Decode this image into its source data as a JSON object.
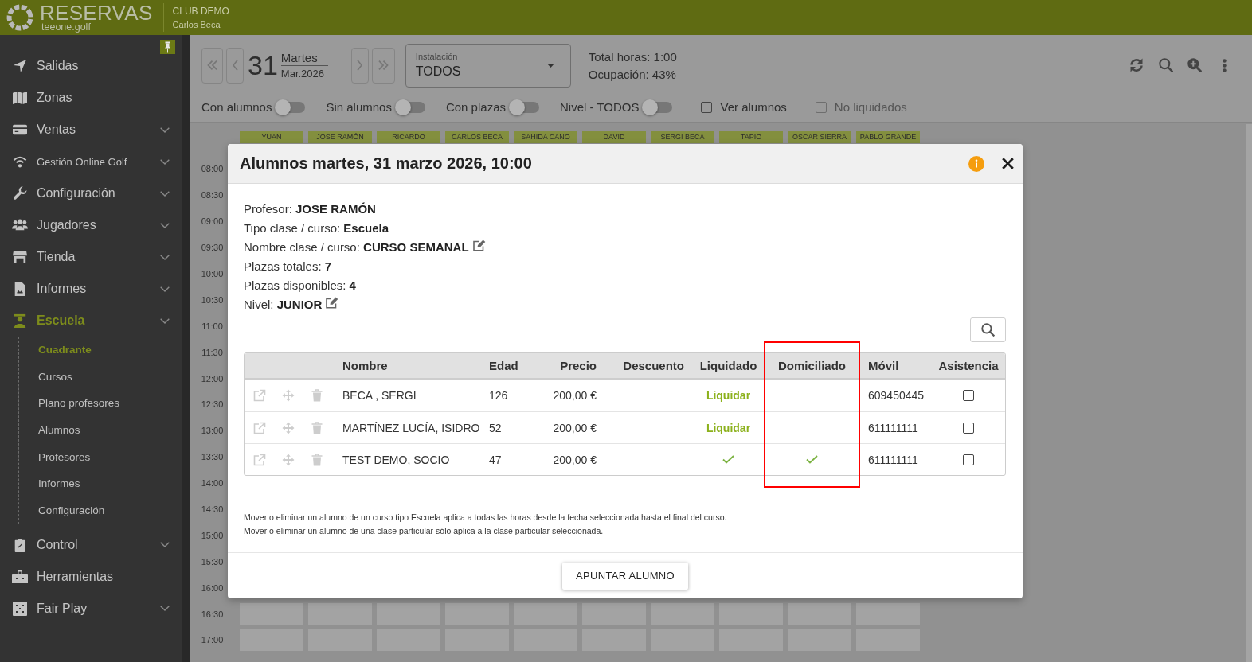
{
  "header": {
    "app_name": "RESERVAS",
    "domain": "teeone.golf",
    "club": "CLUB DEMO",
    "user": "Carlos Beca"
  },
  "sidebar": {
    "items": [
      {
        "label": "Salidas",
        "expandable": false,
        "selected": false
      },
      {
        "label": "Zonas",
        "expandable": false,
        "selected": false
      },
      {
        "label": "Ventas",
        "expandable": true,
        "selected": false
      },
      {
        "label": "Gestión Online Golf",
        "expandable": true,
        "selected": false
      },
      {
        "label": "Configuración",
        "expandable": true,
        "selected": false
      },
      {
        "label": "Jugadores",
        "expandable": true,
        "selected": false
      },
      {
        "label": "Tienda",
        "expandable": true,
        "selected": false
      },
      {
        "label": "Informes",
        "expandable": true,
        "selected": false
      },
      {
        "label": "Escuela",
        "expandable": true,
        "selected": true,
        "children": [
          {
            "label": "Cuadrante",
            "selected": true
          },
          {
            "label": "Cursos",
            "selected": false
          },
          {
            "label": "Plano profesores",
            "selected": false
          },
          {
            "label": "Alumnos",
            "selected": false
          },
          {
            "label": "Profesores",
            "selected": false
          },
          {
            "label": "Informes",
            "selected": false
          },
          {
            "label": "Configuración",
            "selected": false
          }
        ]
      },
      {
        "label": "Control",
        "expandable": true,
        "selected": false
      },
      {
        "label": "Herramientas",
        "expandable": false,
        "selected": false
      },
      {
        "label": "Fair Play",
        "expandable": true,
        "selected": false
      }
    ]
  },
  "toolbar": {
    "date": {
      "day": "31",
      "weekday": "Martes",
      "month": "Mar.2026"
    },
    "installation": {
      "label": "Instalación",
      "value": "TODOS"
    },
    "totals": [
      "Total horas: 1:00",
      "Ocupación: 43%"
    ],
    "filters": [
      {
        "kind": "switch",
        "label": "Con alumnos",
        "on": false,
        "disabled": false
      },
      {
        "kind": "switch",
        "label": "Sin alumnos",
        "on": false,
        "disabled": false
      },
      {
        "kind": "switch",
        "label": "Con plazas",
        "on": false,
        "disabled": false
      },
      {
        "kind": "switch",
        "label": "Nivel - TODOS",
        "on": false,
        "disabled": false
      },
      {
        "kind": "checkbox",
        "label": "Ver alumnos",
        "checked": false,
        "disabled": false
      },
      {
        "kind": "checkbox",
        "label": "No liquidados",
        "checked": false,
        "disabled": true
      }
    ]
  },
  "schedule": {
    "teachers": [
      "YUAN",
      "JOSE RAMÓN",
      "RICARDO",
      "CARLOS BECA",
      "SAHIDA CANO",
      "DAVID",
      "SERGI BECA",
      "TAPIO",
      "OSCAR SIERRA",
      "PABLO GRANDE"
    ],
    "times": [
      "08:00",
      "08:30",
      "09:00",
      "09:30",
      "10:00",
      "10:30",
      "11:00",
      "11:30",
      "12:00",
      "12:30",
      "13:00",
      "13:30",
      "14:00",
      "14:30",
      "15:00",
      "15:30",
      "16:00",
      "16:30",
      "17:00"
    ]
  },
  "dialog": {
    "title": "Alumnos martes, 31 marzo 2026, 10:00",
    "details": [
      {
        "label": "Profesor:",
        "value": "JOSE RAMÓN",
        "editable": false
      },
      {
        "label": "Tipo clase / curso:",
        "value": "Escuela",
        "editable": false
      },
      {
        "label": "Nombre clase / curso:",
        "value": "CURSO SEMANAL",
        "editable": true
      },
      {
        "label": "Plazas totales:",
        "value": "7",
        "editable": false
      },
      {
        "label": "Plazas disponibles:",
        "value": "4",
        "editable": false
      },
      {
        "label": "Nivel:",
        "value": "JUNIOR",
        "editable": true
      }
    ],
    "table": {
      "columns": [
        {
          "label": "Nombre",
          "highlighted": false
        },
        {
          "label": "Edad",
          "highlighted": false
        },
        {
          "label": "Precio",
          "highlighted": false
        },
        {
          "label": "Descuento",
          "highlighted": false
        },
        {
          "label": "Liquidado",
          "highlighted": false
        },
        {
          "label": "Domiciliado",
          "highlighted": true
        },
        {
          "label": "Móvil",
          "highlighted": false
        },
        {
          "label": "Asistencia",
          "highlighted": false
        }
      ],
      "rows": [
        {
          "name": "BECA , SERGI",
          "age": "126",
          "price": "200,00 €",
          "paid": false,
          "pay_link": "Liquidar",
          "direct_debit": false,
          "phone": "609450445",
          "attended": false
        },
        {
          "name": "MARTÍNEZ LUCÍA, ISIDRO",
          "age": "52",
          "price": "200,00 €",
          "paid": false,
          "pay_link": "Liquidar",
          "direct_debit": false,
          "phone": "611111111",
          "attended": false
        },
        {
          "name": "TEST DEMO, SOCIO",
          "age": "47",
          "price": "200,00 €",
          "paid": true,
          "direct_debit": true,
          "phone": "611111111",
          "attended": false
        }
      ]
    },
    "notes": [
      "Mover o eliminar un alumno de un curso tipo Escuela aplica a todas las horas desde la fecha seleccionada hasta el final del curso.",
      "Mover o eliminar un alumno de una clase particular sólo aplica a la clase particular seleccionada."
    ],
    "button": "APUNTAR ALUMNO"
  }
}
